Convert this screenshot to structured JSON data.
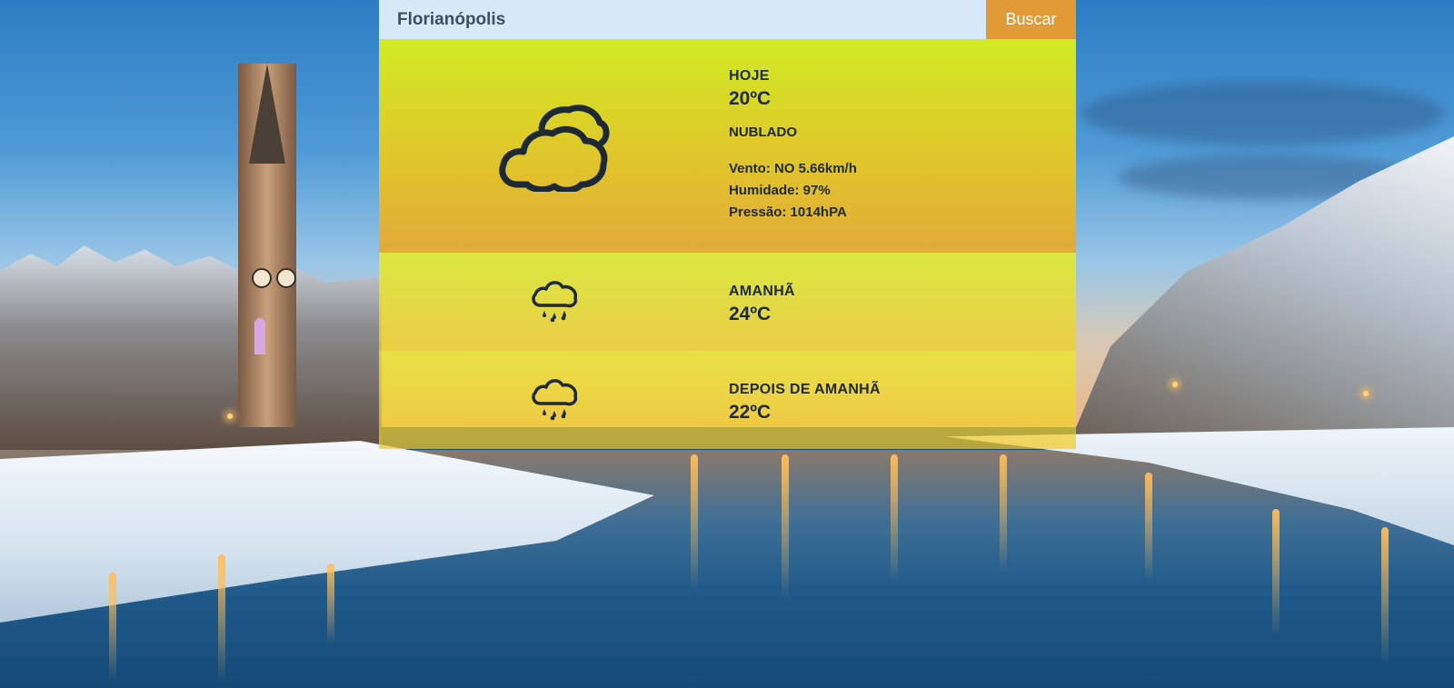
{
  "search": {
    "value": "Florianópolis",
    "placeholder": "",
    "button_label": "Buscar"
  },
  "colors": {
    "accent_button": "#e29a35",
    "panel_yellow": "#e0e81e",
    "text_dark": "#1d2a33"
  },
  "forecast": {
    "today": {
      "label": "HOJE",
      "temp": "20ºC",
      "condition": "NUBLADO",
      "icon": "cloudy-icon",
      "wind": "Vento: NO 5.66km/h",
      "humidity": "Humidade: 97%",
      "pressure": "Pressão: 1014hPA"
    },
    "tomorrow": {
      "label": "AMANHÃ",
      "temp": "24ºC",
      "icon": "rain-cloud-icon"
    },
    "day_after": {
      "label": "DEPOIS DE AMANHÃ",
      "temp": "22ºC",
      "icon": "rain-cloud-icon"
    }
  }
}
